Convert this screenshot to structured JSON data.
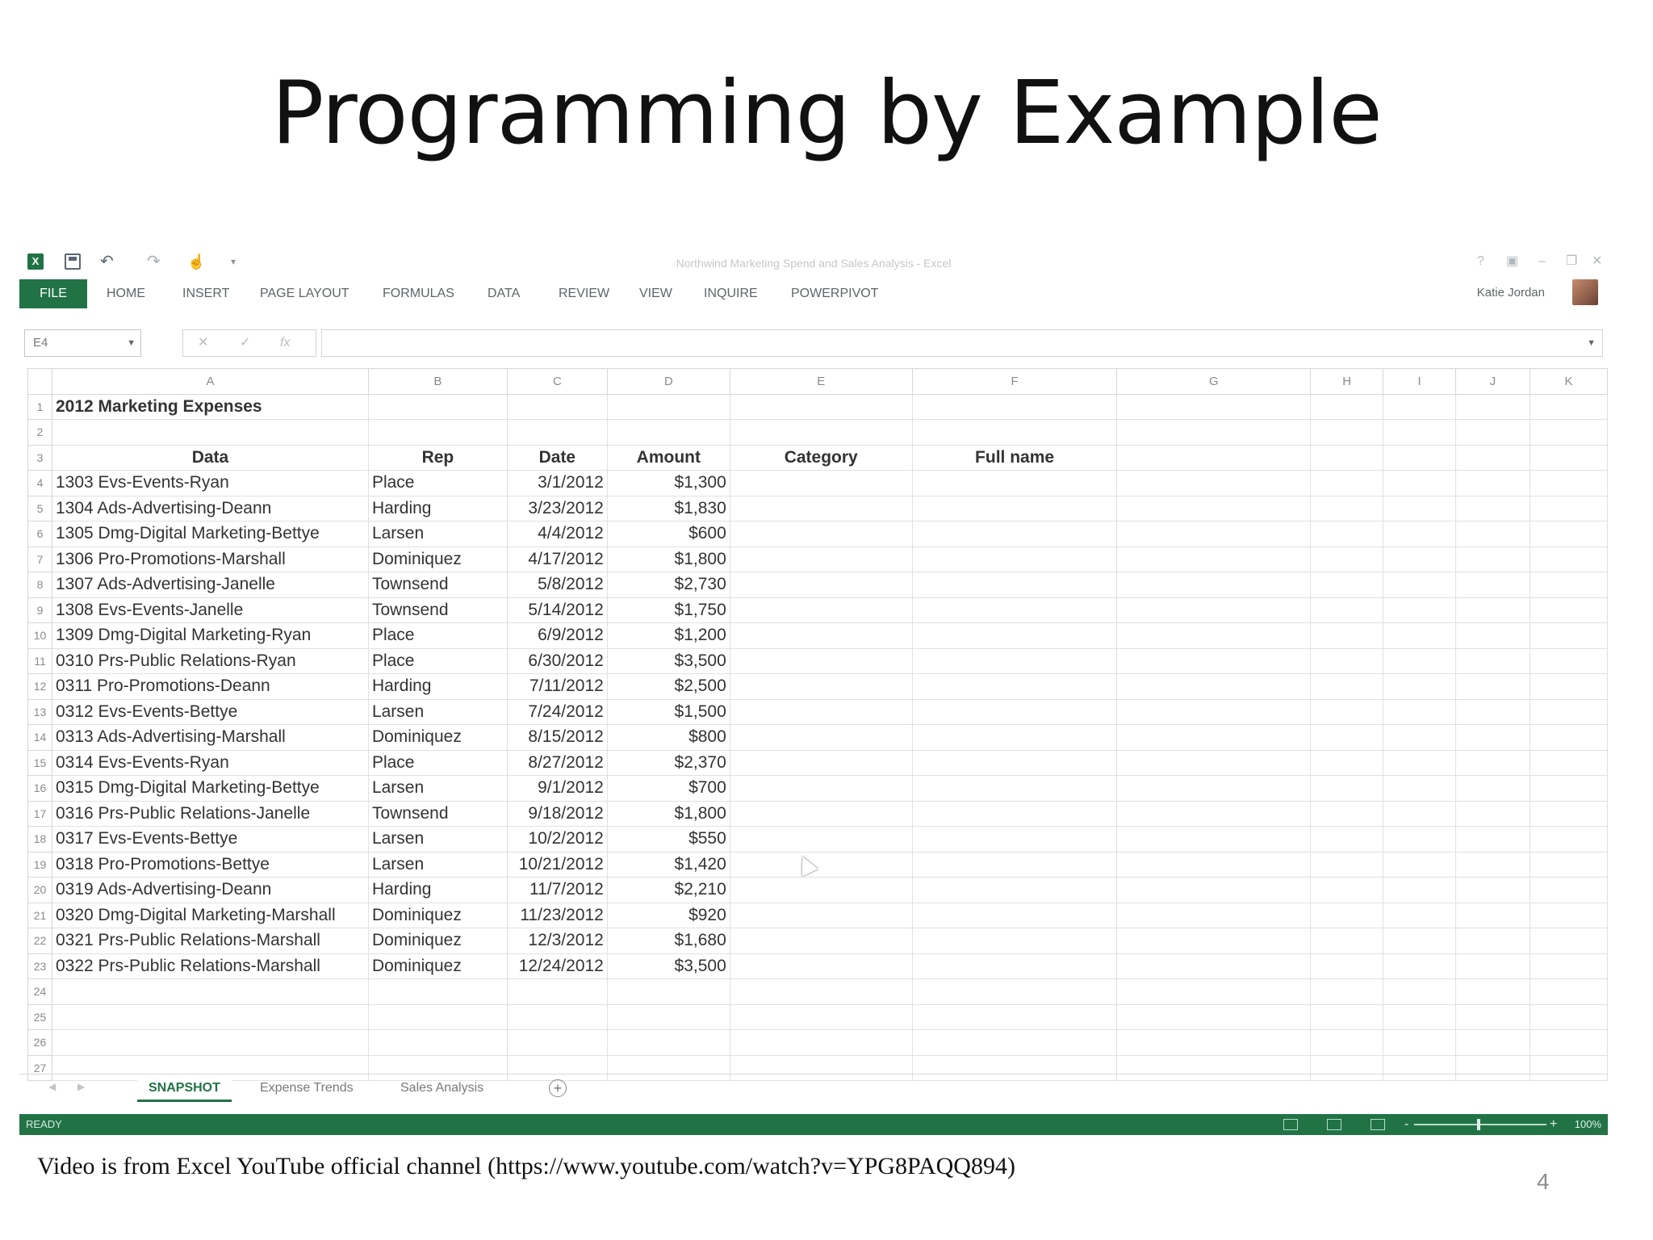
{
  "slide": {
    "title": "Programming by Example",
    "caption": "Video is from Excel YouTube official channel (https://www.youtube.com/watch?v=YPG8PAQQ894)",
    "page_number": "4"
  },
  "excel": {
    "window_title": "Northwind Marketing Spend and Sales Analysis - Excel",
    "ribbon": {
      "file": "FILE",
      "tabs": [
        "HOME",
        "INSERT",
        "PAGE LAYOUT",
        "FORMULAS",
        "DATA",
        "REVIEW",
        "VIEW",
        "INQUIRE",
        "POWERPIVOT"
      ],
      "user": "Katie Jordan"
    },
    "name_box": "E4",
    "formula_value": "",
    "columns": [
      "A",
      "B",
      "C",
      "D",
      "E",
      "F",
      "G",
      "H",
      "I",
      "J",
      "K"
    ],
    "sheet_title": "2012 Marketing Expenses",
    "headers": [
      "Data",
      "Rep",
      "Date",
      "Amount",
      "Category",
      "Full name"
    ],
    "rows": [
      [
        "1303 Evs-Events-Ryan",
        "Place",
        "3/1/2012",
        "$1,300"
      ],
      [
        "1304 Ads-Advertising-Deann",
        "Harding",
        "3/23/2012",
        "$1,830"
      ],
      [
        "1305 Dmg-Digital Marketing-Bettye",
        "Larsen",
        "4/4/2012",
        "$600"
      ],
      [
        "1306 Pro-Promotions-Marshall",
        "Dominiquez",
        "4/17/2012",
        "$1,800"
      ],
      [
        "1307 Ads-Advertising-Janelle",
        "Townsend",
        "5/8/2012",
        "$2,730"
      ],
      [
        "1308 Evs-Events-Janelle",
        "Townsend",
        "5/14/2012",
        "$1,750"
      ],
      [
        "1309 Dmg-Digital Marketing-Ryan",
        "Place",
        "6/9/2012",
        "$1,200"
      ],
      [
        "0310 Prs-Public Relations-Ryan",
        "Place",
        "6/30/2012",
        "$3,500"
      ],
      [
        "0311 Pro-Promotions-Deann",
        "Harding",
        "7/11/2012",
        "$2,500"
      ],
      [
        "0312 Evs-Events-Bettye",
        "Larsen",
        "7/24/2012",
        "$1,500"
      ],
      [
        "0313 Ads-Advertising-Marshall",
        "Dominiquez",
        "8/15/2012",
        "$800"
      ],
      [
        "0314 Evs-Events-Ryan",
        "Place",
        "8/27/2012",
        "$2,370"
      ],
      [
        "0315 Dmg-Digital Marketing-Bettye",
        "Larsen",
        "9/1/2012",
        "$700"
      ],
      [
        "0316 Prs-Public Relations-Janelle",
        "Townsend",
        "9/18/2012",
        "$1,800"
      ],
      [
        "0317 Evs-Events-Bettye",
        "Larsen",
        "10/2/2012",
        "$550"
      ],
      [
        "0318 Pro-Promotions-Bettye",
        "Larsen",
        "10/21/2012",
        "$1,420"
      ],
      [
        "0319 Ads-Advertising-Deann",
        "Harding",
        "11/7/2012",
        "$2,210"
      ],
      [
        "0320 Dmg-Digital Marketing-Marshall",
        "Dominiquez",
        "11/23/2012",
        "$920"
      ],
      [
        "0321 Prs-Public Relations-Marshall",
        "Dominiquez",
        "12/3/2012",
        "$1,680"
      ],
      [
        "0322 Prs-Public Relations-Marshall",
        "Dominiquez",
        "12/24/2012",
        "$3,500"
      ]
    ],
    "sheet_tabs": [
      "SNAPSHOT",
      "Expense Trends",
      "Sales Analysis"
    ],
    "active_sheet": "SNAPSHOT",
    "status": "READY",
    "zoom": "100%",
    "colors": {
      "excel_green": "#217346"
    }
  }
}
